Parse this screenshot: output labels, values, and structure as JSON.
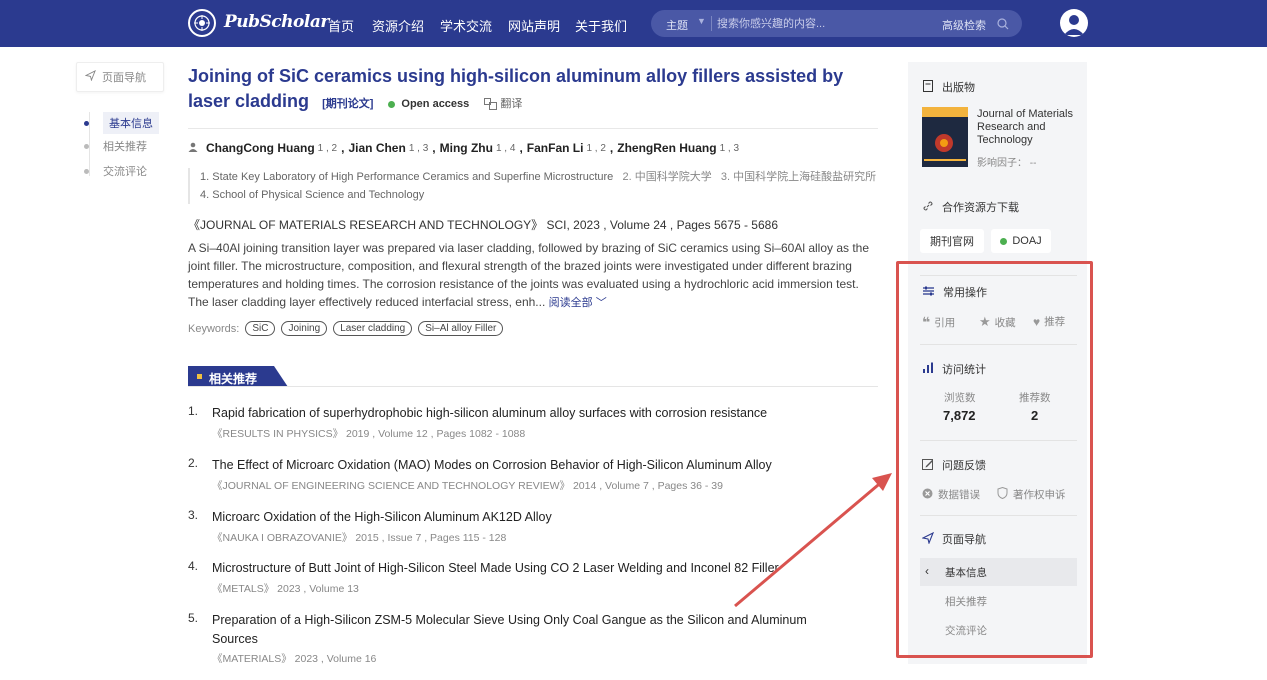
{
  "app": {
    "logo_text": "PubScholar",
    "nav": [
      "首页",
      "资源介绍",
      "学术交流",
      "网站声明",
      "关于我们"
    ],
    "search": {
      "scope": "主题",
      "placeholder": "搜索你感兴趣的内容...",
      "advanced_label": "高级检索"
    }
  },
  "left_nav": {
    "header": "页面导航",
    "items": [
      "基本信息",
      "相关推荐",
      "交流评论"
    ],
    "active_index": 0
  },
  "article": {
    "title": "Joining of SiC ceramics using high-silicon aluminum alloy fillers assisted by laser cladding",
    "type_tag": "[期刊论文]",
    "open_access": "Open access",
    "translate": "翻译",
    "authors": [
      {
        "name": "ChangCong Huang",
        "aff": "1 , 2"
      },
      {
        "name": "Jian Chen",
        "aff": "1 , 3"
      },
      {
        "name": "Ming Zhu",
        "aff": "1 , 4"
      },
      {
        "name": "FanFan Li",
        "aff": "1 , 2"
      },
      {
        "name": "ZhengRen Huang",
        "aff": "1 , 3"
      }
    ],
    "affiliations": {
      "a1": "1. State Key Laboratory of High Performance Ceramics and Superfine Microstructure",
      "a2": "2. 中国科学院大学",
      "a3": "3. 中国科学院上海硅酸盐研究所",
      "a4": "4. School of Physical Science and Technology"
    },
    "journal_line": "《JOURNAL OF MATERIALS RESEARCH AND TECHNOLOGY》 SCI,  2023 , Volume 24 , Pages 5675 - 5686",
    "abstract": "A Si–40Al joining transition layer was prepared via laser cladding, followed by brazing of SiC ceramics using Si–60Al alloy as the joint filler. The microstructure, composition, and flexural strength of the brazed joints were investigated under different brazing temperatures and holding times. The corrosion resistance of the joints was evaluated using a hydrochloric acid immersion test. The laser cladding layer effectively reduced interfacial stress, enh...",
    "read_more": "阅读全部",
    "keywords_label": "Keywords:",
    "keywords": [
      "SiC",
      "Joining",
      "Laser cladding",
      "Si–Al alloy Filler"
    ]
  },
  "related": {
    "heading": "相关推荐",
    "items": [
      {
        "num": "1.",
        "title": "Rapid fabrication of superhydrophobic high-silicon aluminum alloy surfaces with corrosion resistance",
        "meta": "《RESULTS IN PHYSICS》 2019 , Volume 12 , Pages 1082 - 1088"
      },
      {
        "num": "2.",
        "title": "The Effect of Microarc Oxidation (MAO) Modes on Corrosion Behavior of High-Silicon Aluminum Alloy",
        "meta": "《JOURNAL OF ENGINEERING SCIENCE AND TECHNOLOGY REVIEW》 2014 , Volume 7 , Pages 36 - 39"
      },
      {
        "num": "3.",
        "title": "Microarc Oxidation of the High-Silicon Aluminum AK12D Alloy",
        "meta": "《NAUKA I OBRAZOVANIE》 2015 , Issue 7 , Pages 115 - 128"
      },
      {
        "num": "4.",
        "title": "Microstructure of Butt Joint of High-Silicon Steel Made Using CO 2 Laser Welding and Inconel 82 Filler",
        "meta": "《METALS》 2023 , Volume 13"
      },
      {
        "num": "5.",
        "title": "Preparation of a High-Silicon ZSM-5 Molecular Sieve Using Only Coal Gangue as the Silicon and Aluminum Sources",
        "meta": "《MATERIALS》 2023 , Volume 16"
      }
    ]
  },
  "sidebar": {
    "publication_label": "出版物",
    "journal_name": "Journal of Materials Research and Technology",
    "impact_factor": "影响因子： --",
    "download_label": "合作资源方下载",
    "btn_official": "期刊官网",
    "btn_doaj": "DOAJ",
    "common_ops_label": "常用操作",
    "ops": [
      "引用",
      "收藏",
      "推荐"
    ],
    "stats_label": "访问统计",
    "views_label": "浏览数",
    "views_value": "7,872",
    "recs_label": "推荐数",
    "recs_value": "2",
    "feedback_label": "问题反馈",
    "feedback_items": [
      "数据错误",
      "著作权申诉"
    ],
    "page_nav_label": "页面导航",
    "page_nav_items": [
      "基本信息",
      "相关推荐",
      "交流评论"
    ]
  },
  "colors": {
    "brand": "#2b3a8f",
    "highlight": "#d9534f",
    "oa_green": "#4caf50"
  }
}
